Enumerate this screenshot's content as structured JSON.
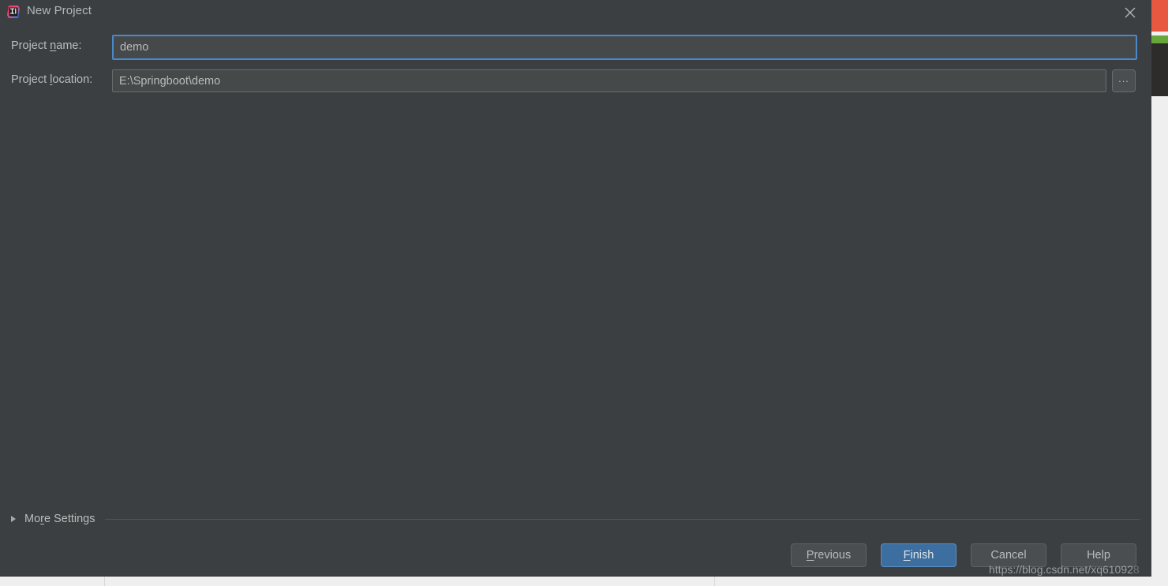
{
  "dialog": {
    "title": "New Project",
    "icon": "intellij-idea-icon",
    "close_icon": "close-icon",
    "accent_focus_color": "#4a88c7",
    "default_button_color": "#3c6ea0",
    "background_color": "#3c3f41",
    "field_background_color": "#45494a",
    "text_color": "#bbbbbb"
  },
  "form": {
    "fields": [
      {
        "label": "Project ",
        "label_mnemonic": "n",
        "label_rest": "ame:",
        "value": "demo",
        "placeholder": "",
        "focused": true
      },
      {
        "label": "Project ",
        "label_mnemonic": "l",
        "label_rest": "ocation:",
        "value": "E:\\Springboot\\demo",
        "placeholder": "",
        "focused": false
      }
    ],
    "browse_button_label": "..."
  },
  "more_settings": {
    "label_start": "Mo",
    "label_mnemonic": "r",
    "label_rest": "e Settings",
    "expanded": false,
    "arrow_icon": "chevron-right-icon"
  },
  "footer": {
    "buttons": [
      {
        "label_start": "",
        "mnemonic": "P",
        "label_rest": "revious",
        "default": false
      },
      {
        "label_start": "",
        "mnemonic": "F",
        "label_rest": "inish",
        "default": true
      },
      {
        "label_start": "Cancel",
        "mnemonic": "",
        "label_rest": "",
        "default": false
      },
      {
        "label_start": "Help",
        "mnemonic": "",
        "label_rest": "",
        "default": false
      }
    ]
  },
  "watermark": {
    "text_visible": "https://blog.csdn.net/xq61092",
    "text_faded": "8"
  },
  "background": {
    "red_block_color": "#e8573f",
    "green_strip_color": "#66a63a",
    "dark_block_color": "#2e2c2b",
    "desktop_color": "#efefef"
  }
}
